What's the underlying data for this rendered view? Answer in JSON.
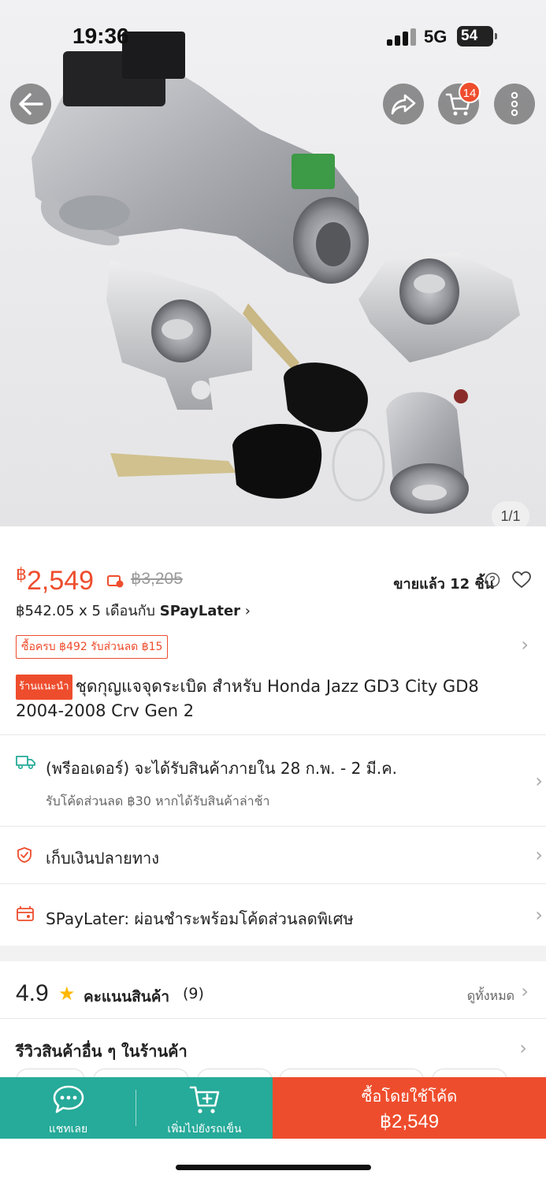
{
  "status_bar": {
    "time": "19:36",
    "network": "5G",
    "battery": "54"
  },
  "header": {
    "back_icon": "arrow-left-icon",
    "share_icon": "share-icon",
    "cart_icon": "cart-icon",
    "cart_count": "14",
    "more_icon": "more-vertical-icon"
  },
  "image": {
    "counter": "1/1"
  },
  "price": {
    "currency": "฿",
    "current": "2,549",
    "original": "฿3,205",
    "sold": "ขายแล้ว 12 ชิ้น",
    "installment_prefix": "฿542.05 x 5 เดือนกับ",
    "installment_brand": "SPayLater",
    "installment_chevron": "›"
  },
  "voucher": {
    "label": "ซื้อครบ ฿492 รับส่วนลด ฿15"
  },
  "product": {
    "badge": "ร้านแนะนำ",
    "title": "ชุดกุญแจจุดระเบิด สำหรับ Honda Jazz GD3 City GD8 2004-2008 Crv Gen 2"
  },
  "shipping": {
    "text": "(พรีออเดอร์) จะได้รับสินค้าภายใน 28 ก.พ. - 2 มี.ค.",
    "sub": "รับโค้ดส่วนลด ฿30 หากได้รับสินค้าล่าช้า"
  },
  "cod": {
    "text": "เก็บเงินปลายทาง"
  },
  "spaylater_row": {
    "text": "SPayLater: ผ่อนชำระพร้อมโค้ดส่วนลดพิเศษ"
  },
  "rating": {
    "score": "4.9",
    "label": "คะแนนสินค้า",
    "count": "(9)",
    "see_all": "ดูทั้งหมด"
  },
  "shop_reviews": {
    "title": "รีวิวสินค้าอื่น ๆ ในร้านค้า"
  },
  "bottom_bar": {
    "chat_label": "แชทเลย",
    "add_cart_label": "เพิ่มไปยังรถเข็น",
    "buy_label": "ซื้อโดยใช้โค้ด",
    "buy_price": "฿2,549"
  },
  "colors": {
    "accent": "#ee4d2d",
    "teal": "#26aa99",
    "star": "#ffb800"
  }
}
